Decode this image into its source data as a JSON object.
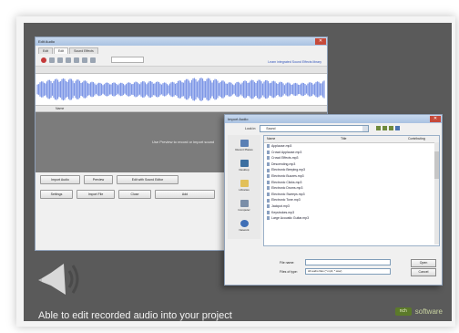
{
  "caption": "Able to edit recorded audio into your project",
  "brand": "nch",
  "brand_text": "software",
  "edit_audio": {
    "title": "Edit Audio",
    "tabs": [
      "Edit",
      "Edit",
      "Sound Effects"
    ],
    "link_text": "Learn integrated Sound Effects library",
    "list_header": [
      "",
      "Name"
    ],
    "track_hint": "Use Preview to record or import sound",
    "buttons_row1": [
      "Import Audio",
      "Preview",
      "Edit with Sound Editor"
    ],
    "buttons_row2": [
      "Settings",
      "Import File",
      "Close",
      "Add"
    ]
  },
  "import_audio": {
    "title": "Import Audio",
    "look_in_label": "Look in:",
    "look_in_value": "Sound",
    "places": [
      "Recent Places",
      "Desktop",
      "Libraries",
      "Computer",
      "Network"
    ],
    "columns": [
      "Name",
      "Title",
      "Contributing"
    ],
    "files": [
      "Applause.mp3",
      "Crowd Applause.mp3",
      "Crowd Effects.mp3",
      "Descending.mp3",
      "Electronic Beeping.mp3",
      "Electronic Buzzes.mp3",
      "Electronic Clicks.mp3",
      "Electronic Drums.mp3",
      "Electronic Sweeps.mp3",
      "Electronic Tone.mp3",
      "Jackpot.mp3",
      "Keystrokes.mp3",
      "Large Acoustic Guitar.mp3"
    ],
    "file_name_label": "File name:",
    "file_name_value": "",
    "files_type_label": "Files of type:",
    "files_type_value": "All audio files (*.mp3, *.wav)",
    "open_button": "Open",
    "cancel_button": "Cancel"
  },
  "colors": {
    "waveform": "#7d96e6",
    "slide_bg": "#5a5a5a",
    "titlebar": "#a9c2e2"
  }
}
